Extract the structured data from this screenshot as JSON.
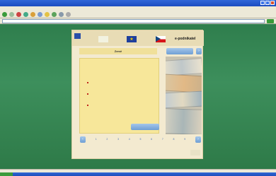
{
  "window": {
    "title": ""
  },
  "menu": {
    "items": [
      "",
      "",
      "",
      "",
      "",
      ""
    ]
  },
  "address": {
    "value": ""
  },
  "header": {
    "brand": "e-podnikatel",
    "logo_text": ""
  },
  "section": {
    "title": "Země",
    "top_button": ""
  },
  "content": {
    "heading": "",
    "questions": [
      "",
      "",
      ""
    ],
    "button": ""
  },
  "pager": {
    "pages": [
      "1",
      "2",
      "3",
      "4",
      "5",
      "6",
      "7",
      "8",
      "9"
    ]
  },
  "footer": {
    "logo": "",
    "text": ""
  },
  "status": {
    "text": ""
  },
  "colors": {
    "page_bg": "#3a8a5a",
    "accent_blue": "#6f9fd4",
    "question_red": "#c0261c"
  }
}
